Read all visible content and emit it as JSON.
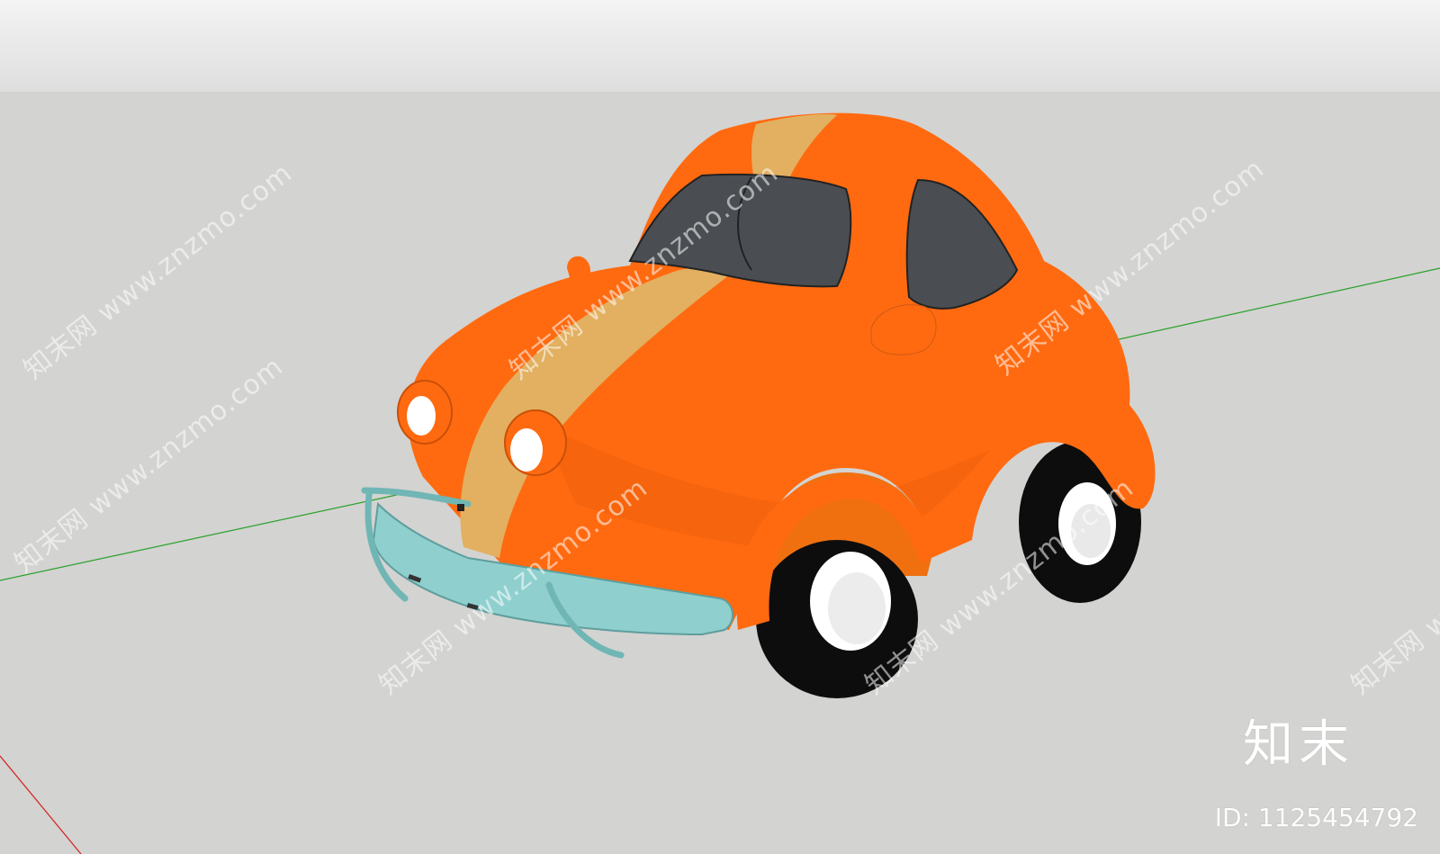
{
  "scene": {
    "sky_color": "#ececec",
    "ground_color": "#d3d3d1",
    "axis_colors": {
      "green": "#2aa12a",
      "red": "#d02020"
    },
    "car_colors": {
      "body": "#ff6a10",
      "stripe": "#e2b060",
      "window": "#4a4e52",
      "bumper": "#8fd0cf",
      "tire": "#0d0d0d",
      "hub": "#ffffff"
    }
  },
  "watermark": {
    "text": "知末网 www.znzmo.com"
  },
  "branding": {
    "logo_text": "知末",
    "id_label": "ID: 1125454792"
  }
}
